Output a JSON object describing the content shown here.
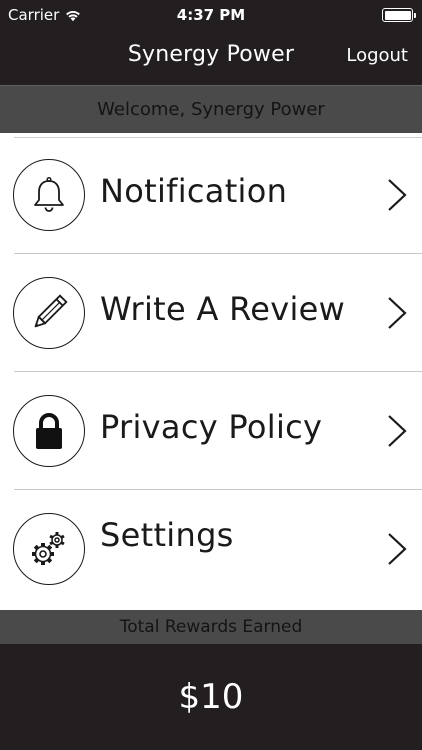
{
  "status_bar": {
    "carrier": "Carrier",
    "time": "4:37 PM",
    "battery_level": 1.0
  },
  "nav": {
    "title": "Synergy Power",
    "logout_label": "Logout"
  },
  "welcome_text": "Welcome, Synergy Power",
  "menu": {
    "items": [
      {
        "label": "Notification",
        "icon": "bell-icon"
      },
      {
        "label": "Write A Review",
        "icon": "pencil-icon"
      },
      {
        "label": "Privacy Policy",
        "icon": "lock-icon"
      },
      {
        "label": "Settings",
        "icon": "gears-icon"
      }
    ]
  },
  "rewards": {
    "label": "Total Rewards Earned",
    "amount": "$10"
  },
  "colors": {
    "nav_background": "#231f20",
    "bar_background": "#4a4a4a",
    "list_background": "#ffffff",
    "text_dark": "#1a1a1a"
  }
}
